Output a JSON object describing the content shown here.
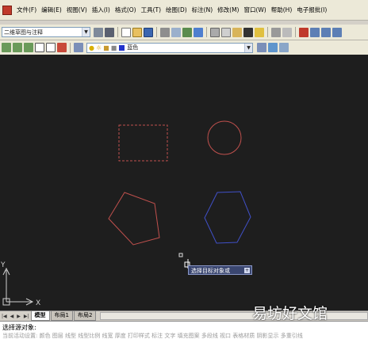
{
  "menubar": {
    "items": [
      "文件(F)",
      "编辑(E)",
      "视图(V)",
      "插入(I)",
      "格式(O)",
      "工具(T)",
      "绘图(D)",
      "标注(N)",
      "修改(M)",
      "窗口(W)",
      "帮助(H)",
      "电子报批(I)"
    ]
  },
  "toolbar": {
    "workspace_combo": "二维草图与注释",
    "layer_combo_value": "",
    "color_combo_value": "蓝色"
  },
  "canvas": {
    "ucs_y_label": "Y",
    "ucs_x_label": "X",
    "shapes": [
      {
        "type": "dashed-rectangle",
        "color": "#c0504d"
      },
      {
        "type": "circle",
        "color": "#c0504d"
      },
      {
        "type": "pentagon",
        "color": "#c0504d"
      },
      {
        "type": "hexagon",
        "color": "#4050c8"
      }
    ]
  },
  "tooltip": {
    "text": "选择目标对象或",
    "button": "+"
  },
  "layout_tabs": {
    "tabs": [
      "模型",
      "布局1",
      "布局2"
    ],
    "active": "模型"
  },
  "command_line": {
    "line1": "选择源对象:",
    "line2": "当前活动设置: 颜色 图层 线型 线型比例 线宽 厚度 打印样式 标注 文字 填充图案 多段线 视口 表格材质 阴影显示 多重引线"
  },
  "watermark": "易坊好文馆"
}
